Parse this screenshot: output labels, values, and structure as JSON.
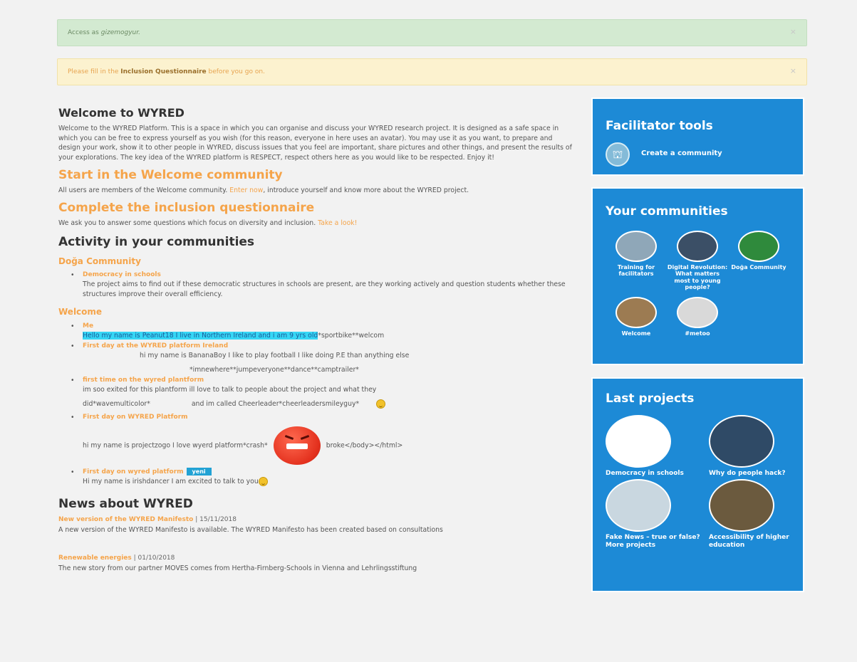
{
  "alerts": {
    "success_prefix": "Access as ",
    "success_user": "gizemogyur.",
    "close": "×",
    "warning_prefix": "Please fill in the ",
    "warning_bold": "Inclusion Questionnaire",
    "warning_suffix": " before you go on."
  },
  "main": {
    "welcome_title": "Welcome to WYRED",
    "welcome_text": "Welcome to the WYRED Platform. This is a space in which you can organise and discuss your WYRED research project. It is designed as a safe space in which you can be free to express yourself as you wish (for this reason, everyone in here uses an avatar). You may use it as you want, to prepare and design your work, show it to other people in WYRED, discuss issues that you feel are important, share pictures and other things, and present the results of your explorations. The key idea of the WYRED platform is RESPECT, respect others here as you would like to be respected. Enjoy it!",
    "start_title": "Start in the Welcome community",
    "start_text_1": "All users are members of the Welcome community. ",
    "start_link": "Enter now",
    "start_text_2": ", introduce yourself and know more about the WYRED project.",
    "incl_title": "Complete the inclusion questionnaire",
    "incl_text": "We ask you to answer some questions which focus on diversity and inclusion. ",
    "incl_link": "Take a look!",
    "activity_title": "Activity in your communities",
    "doga_title": "Doğa Community",
    "doga_item_title": "Democracy in schools",
    "doga_item_body": "The project aims to find out if these democratic structures in schools are present, are they working actively and question students whether these structures improve their overall efficiency.",
    "welcome_comm_title": "Welcome",
    "w1_title": "Me",
    "w1_hl": "Hello my name is Peanut18 I live in Northern Ireland and i am 9 yrs old",
    "w1_rest": "*sportbike**welcom",
    "w2_title": "First day at the WYRED platform Ireland",
    "w2_body1": "hi my name is BananaBoy I like to play football I like doing P.E than anything else",
    "w2_body2": "*imnewhere**jumpeveryone**dance**camptrailer*",
    "w3_title": "first time on the wyred plantform",
    "w3_body1": "im soo exited for this plantform ill love to talk to people about the project and what they",
    "w3_body2a": "did*wavemulticolor*",
    "w3_body2b": "and im called Cheerleader*cheerleadersmileyguy*",
    "w4_title": "First day on WYRED Platform",
    "w4_body": "hi my name is projectzogo I love wyerd platform*crash*",
    "w4_broken": "broke</body></html>",
    "w5_title": "First day on wyred platform",
    "w5_badge": "yeni",
    "w5_body": "Hi my name is irishdancer I am excited to talk to you",
    "news_title": "News about WYRED",
    "n1_title": "New version of the WYRED Manifesto",
    "n1_date": " | 15/11/2018",
    "n1_text": "A new version of the WYRED Manifesto is available. The WYRED Manifesto has been created based on consultations",
    "n2_title": "Renewable energies",
    "n2_date": " | 01/10/2018",
    "n2_text": "The new story from our partner MOVES comes from Hertha-Firnberg-Schools in Vienna and Lehrlingsstiftung"
  },
  "sidebar": {
    "ft_title": "Facilitator tools",
    "ft_link": "Create a community",
    "yc_title": "Your communities",
    "communities": [
      {
        "label": "Training for facilitators",
        "color": "#8fa7b8"
      },
      {
        "label": "Digital Revolution: What matters most to young people?",
        "color": "#3b4f66"
      },
      {
        "label": "Doğa Community",
        "color": "#2f8a3c"
      },
      {
        "label": "Welcome",
        "color": "#9c7b52"
      },
      {
        "label": "#metoo",
        "color": "#d9d9d9"
      }
    ],
    "lp_title": "Last projects",
    "projects": [
      {
        "label": "Democracy in schools",
        "color": "#ffffff"
      },
      {
        "label": "Why do people hack?",
        "color": "#2f4a66"
      },
      {
        "label": "Fake News – true or false?",
        "color": "#c9d7e0"
      },
      {
        "label": "Accessibility of higher education",
        "color": "#6b5a3e"
      }
    ],
    "lp_more": "More projects"
  }
}
